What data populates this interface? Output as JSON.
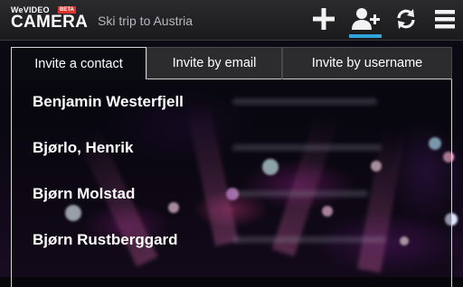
{
  "app": {
    "logo_top": "WeVIDEO",
    "logo_badge": "BETA",
    "logo_main": "CAMERA",
    "project_title": "Ski trip to Austria"
  },
  "toolbar": {
    "actions": [
      {
        "icon": "plus-icon"
      },
      {
        "icon": "add-user-icon",
        "active": true
      },
      {
        "icon": "sync-icon"
      },
      {
        "icon": "menu-icon"
      }
    ],
    "accent": "#2fa4d8"
  },
  "tabs": [
    {
      "label": "Invite a contact",
      "selected": true
    },
    {
      "label": "Invite by email",
      "selected": false
    },
    {
      "label": "Invite by username",
      "selected": false
    }
  ],
  "contacts": [
    {
      "name": "Benjamin Westerfjell"
    },
    {
      "name": "Bjørlo, Henrik"
    },
    {
      "name": "Bjørn Molstad"
    },
    {
      "name": "Bjørn Rustberggard"
    }
  ]
}
